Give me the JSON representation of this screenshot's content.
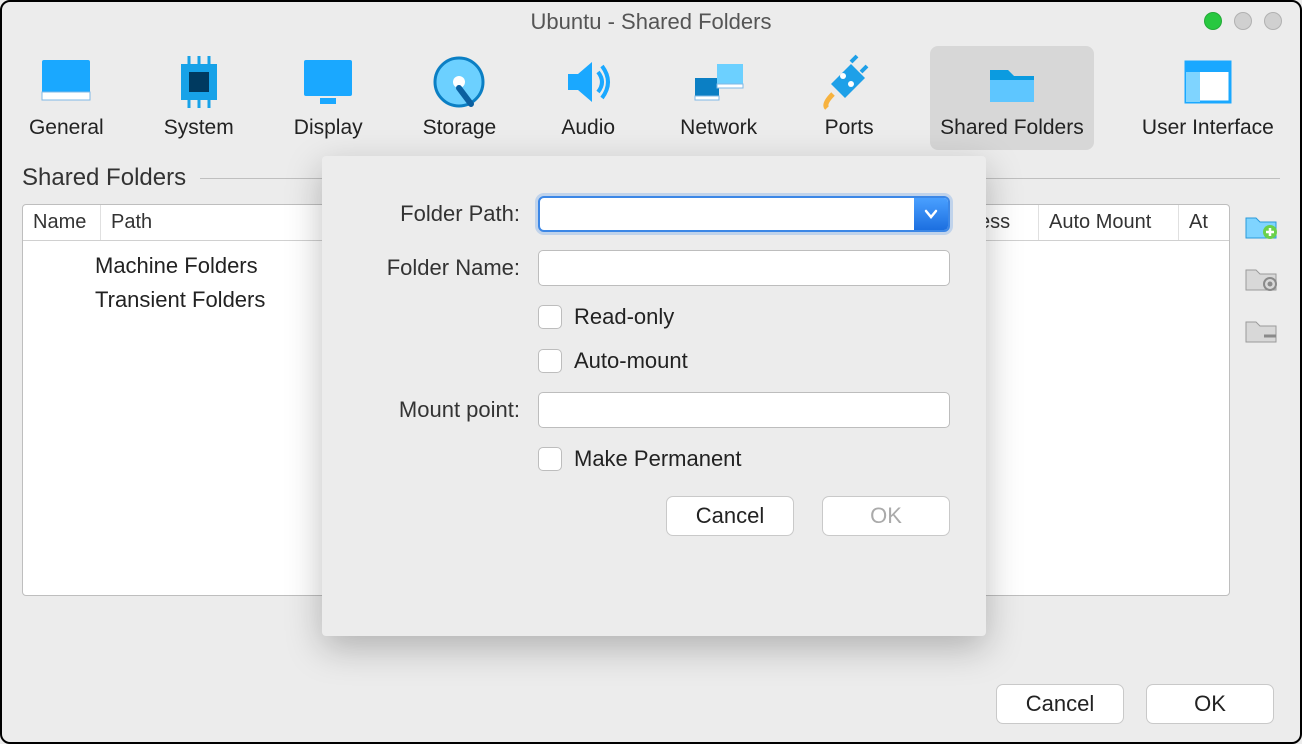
{
  "title": "Ubuntu - Shared Folders",
  "toolbar": [
    {
      "label": "General"
    },
    {
      "label": "System"
    },
    {
      "label": "Display"
    },
    {
      "label": "Storage"
    },
    {
      "label": "Audio"
    },
    {
      "label": "Network"
    },
    {
      "label": "Ports"
    },
    {
      "label": "Shared Folders"
    },
    {
      "label": "User Interface"
    }
  ],
  "section_title": "Shared Folders",
  "table": {
    "columns": {
      "name": "Name",
      "path": "Path",
      "access": "ess",
      "automount": "Auto Mount",
      "at": "At"
    },
    "groups": [
      "Machine Folders",
      "Transient Folders"
    ]
  },
  "popup": {
    "labels": {
      "folder_path": "Folder Path:",
      "folder_name": "Folder Name:",
      "mount_point": "Mount point:",
      "read_only": "Read-only",
      "auto_mount": "Auto-mount",
      "make_permanent": "Make Permanent"
    },
    "values": {
      "folder_path": "",
      "folder_name": "",
      "mount_point": ""
    },
    "buttons": {
      "cancel": "Cancel",
      "ok": "OK"
    }
  },
  "bottom_buttons": {
    "cancel": "Cancel",
    "ok": "OK"
  },
  "colors": {
    "accent": "#1c9cf0"
  }
}
